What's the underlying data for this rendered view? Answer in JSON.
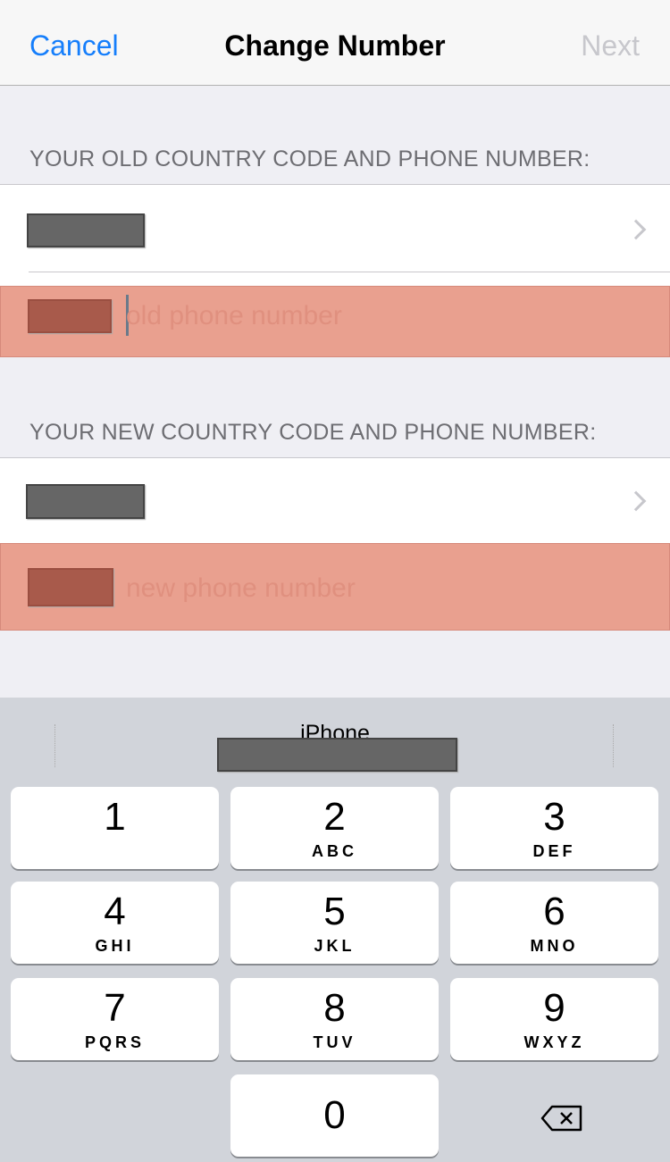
{
  "nav": {
    "cancel": "Cancel",
    "title": "Change Number",
    "next": "Next"
  },
  "old_section": {
    "header": "YOUR OLD COUNTRY CODE AND PHONE NUMBER:",
    "placeholder": "old phone number"
  },
  "new_section": {
    "header": "YOUR NEW COUNTRY CODE AND PHONE NUMBER:",
    "placeholder": "new phone number"
  },
  "keyboard": {
    "suggestion_label": "iPhone",
    "keys": [
      {
        "digit": "1",
        "letters": ""
      },
      {
        "digit": "2",
        "letters": "ABC"
      },
      {
        "digit": "3",
        "letters": "DEF"
      },
      {
        "digit": "4",
        "letters": "GHI"
      },
      {
        "digit": "5",
        "letters": "JKL"
      },
      {
        "digit": "6",
        "letters": "MNO"
      },
      {
        "digit": "7",
        "letters": "PQRS"
      },
      {
        "digit": "8",
        "letters": "TUV"
      },
      {
        "digit": "9",
        "letters": "WXYZ"
      },
      {
        "digit": "0",
        "letters": ""
      }
    ],
    "delete_icon": "backspace-icon"
  },
  "colors": {
    "accent": "#157efb",
    "highlight": "#e9a08f"
  }
}
